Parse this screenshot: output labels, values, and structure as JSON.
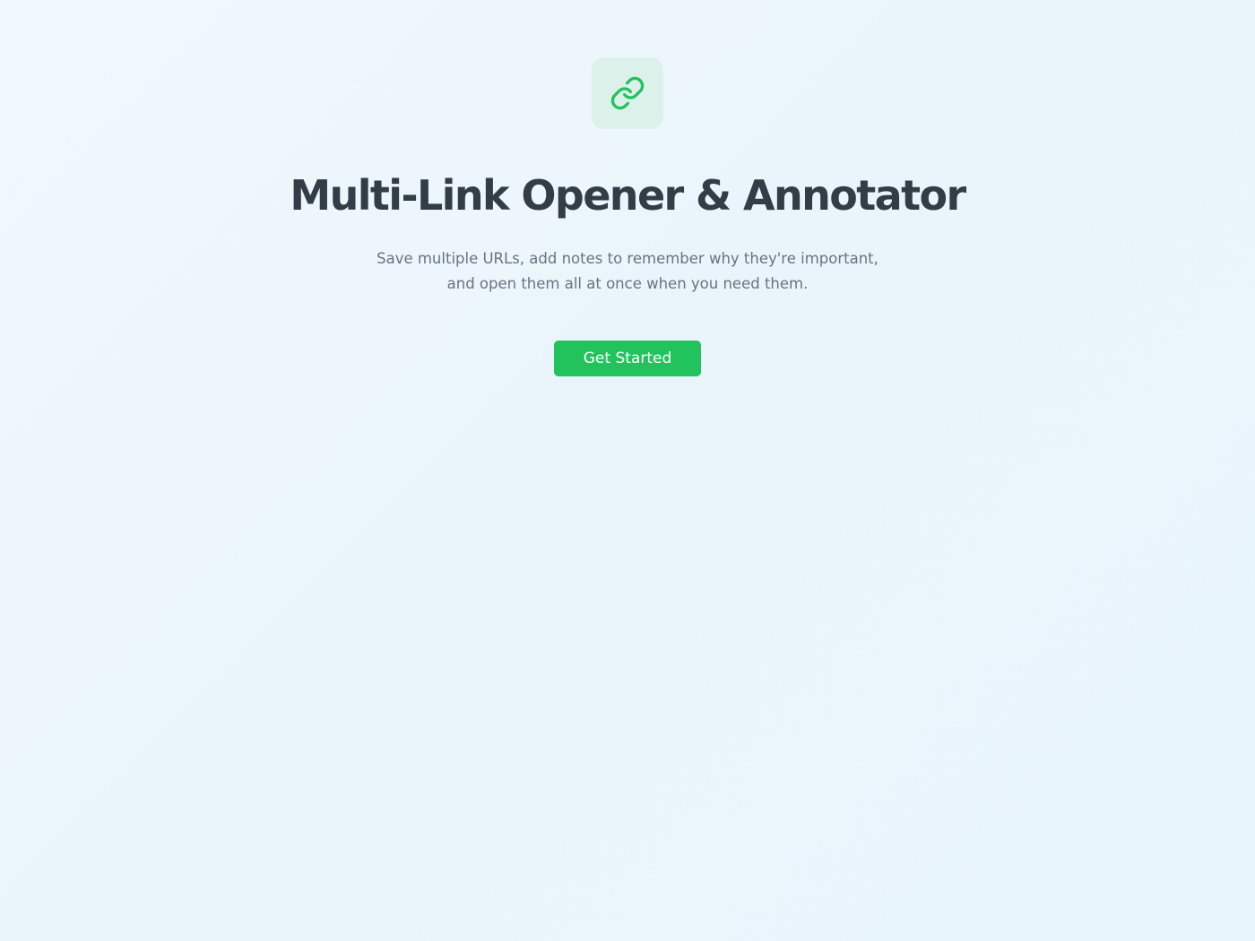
{
  "app": {
    "icon": "link-icon",
    "title": "Multi-Link Opener & Annotator",
    "subtitle_line1": "Save multiple URLs, add notes to remember why they're important,",
    "subtitle_line2": "and open them all at once when you need them.",
    "cta_label": "Get Started"
  },
  "colors": {
    "accent": "#22c35d",
    "icon_tile": "#dcf1ea",
    "title": "#333d47",
    "subtitle": "#6b7280",
    "background": "#eef7fc"
  }
}
